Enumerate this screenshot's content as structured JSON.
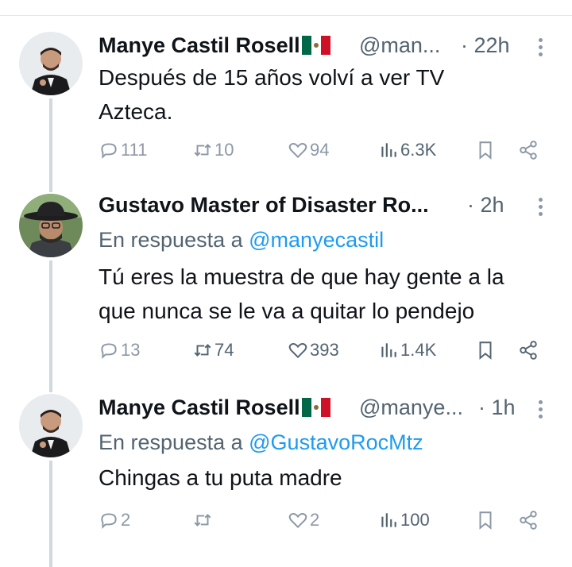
{
  "tweets": [
    {
      "name": "Manye Castil Rosell",
      "handle": "@man...",
      "time": "· 22h",
      "reply_prefix": "",
      "reply_to": "",
      "text_lines": [
        "Después de 15 años volví a ver TV",
        "Azteca."
      ],
      "replies": "111",
      "retweets": "10",
      "likes": "94",
      "views": "6.3K"
    },
    {
      "name": "Gustavo Master of Disaster Ro...",
      "handle": "",
      "time": "· 2h",
      "reply_prefix": "En respuesta a",
      "reply_to": "@manyecastil",
      "text_lines": [
        "Tú eres la muestra de que hay gente a la",
        "que nunca se le va a quitar lo pendejo"
      ],
      "replies": "13",
      "retweets": "74",
      "likes": "393",
      "views": "1.4K"
    },
    {
      "name": "Manye Castil Rosell",
      "handle": "@manye...",
      "time": "· 1h",
      "reply_prefix": "En respuesta a",
      "reply_to": "@GustavoRocMtz",
      "text_lines": [
        "Chingas a tu puta madre"
      ],
      "replies": "2",
      "retweets": "",
      "likes": "2",
      "views": "100"
    }
  ],
  "colors": {
    "text": "#0f1419",
    "secondary": "#536471",
    "muted": "#8b98a5",
    "link": "#1d9bf0",
    "thread_line": "#cfd9de"
  },
  "icons": [
    "reply-icon",
    "retweet-icon",
    "like-icon",
    "views-icon",
    "bookmark-icon",
    "share-icon",
    "more-icon",
    "mexico-flag-icon"
  ]
}
